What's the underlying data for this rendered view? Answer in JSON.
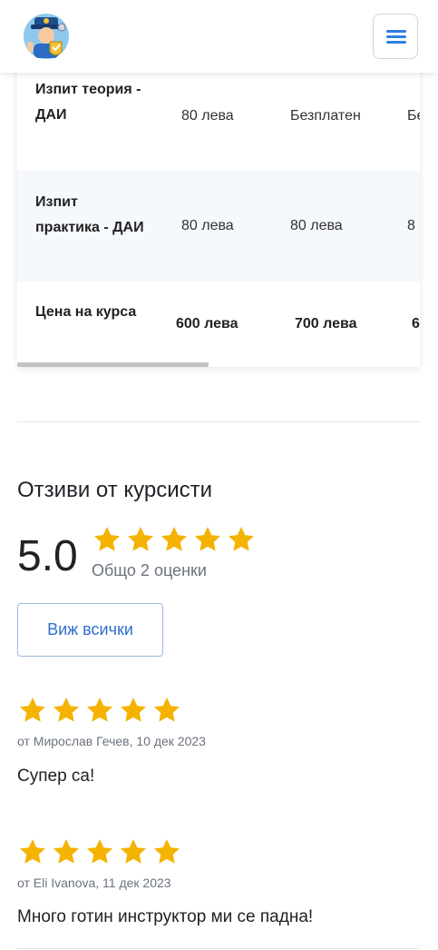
{
  "header": {
    "logo_icon": "driving-instructor-mascot-icon",
    "menu_icon": "hamburger-menu-icon",
    "accent_color": "#2f7fe0"
  },
  "price_table": {
    "rows": [
      {
        "label": "Изпит теория - ДАИ",
        "values": [
          "80 лева",
          "Безплатен",
          "Бе"
        ]
      },
      {
        "label": "Изпит практика - ДАИ",
        "values": [
          "80 лева",
          "80 лева",
          "8"
        ]
      },
      {
        "label": "Цена на курса",
        "values": [
          "600 лева",
          "700 лева",
          "6"
        ]
      }
    ],
    "horizontal_scroll_position": 0
  },
  "reviews": {
    "title": "Отзиви от курсисти",
    "average": "5.0",
    "stars": 5,
    "summary": "Общо 2 оценки",
    "view_all_label": "Виж всички",
    "star_color": "#f5b301",
    "items": [
      {
        "stars": 5,
        "meta": "от Мирослав Гечев, 10 дек 2023",
        "text": "Супер са!"
      },
      {
        "stars": 5,
        "meta": "от Eli Ivanova, 11 дек 2023",
        "text": "Много готин инструктор ми се падна!"
      }
    ]
  }
}
